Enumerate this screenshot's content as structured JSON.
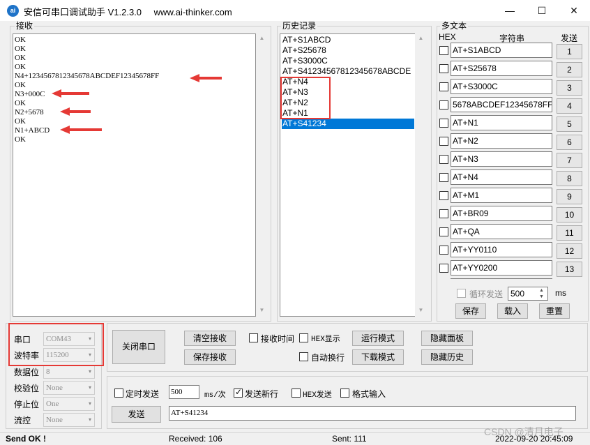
{
  "titlebar": {
    "logo_text": "ai",
    "title": "安信可串口调试助手 V1.2.3.0",
    "url": "www.ai-thinker.com",
    "minimize": "—",
    "maximize": "☐",
    "close": "✕"
  },
  "receive": {
    "label": "接收",
    "lines": [
      "OK",
      "OK",
      "OK",
      "OK",
      "N4+1234567812345678ABCDEF12345678FF",
      "OK",
      "N3+000C",
      "OK",
      "N2+5678",
      "OK",
      "N1+ABCD",
      "OK"
    ]
  },
  "history": {
    "label": "历史记录",
    "items": [
      "AT+S1ABCD",
      "AT+S25678",
      "AT+S3000C",
      "AT+S41234567812345678ABCDE",
      "AT+N4",
      "AT+N3",
      "AT+N2",
      "AT+N1",
      "AT+S41234"
    ],
    "selected_index": 8
  },
  "multitext": {
    "label": "多文本",
    "col_hex": "HEX",
    "col_string": "字符串",
    "col_send": "发送",
    "rows": [
      {
        "value": "AT+S1ABCD",
        "button": "1"
      },
      {
        "value": "AT+S25678",
        "button": "2"
      },
      {
        "value": "AT+S3000C",
        "button": "3"
      },
      {
        "value": "5678ABCDEF12345678FF",
        "button": "4"
      },
      {
        "value": "AT+N1",
        "button": "5"
      },
      {
        "value": "AT+N2",
        "button": "6"
      },
      {
        "value": "AT+N3",
        "button": "7"
      },
      {
        "value": "AT+N4",
        "button": "8"
      },
      {
        "value": "AT+M1",
        "button": "9"
      },
      {
        "value": "AT+BR09",
        "button": "10"
      },
      {
        "value": "AT+QA",
        "button": "11"
      },
      {
        "value": "AT+YY0110",
        "button": "12"
      },
      {
        "value": "AT+YY0200",
        "button": "13"
      }
    ],
    "loop_send_label": "循环发送",
    "loop_interval": "500",
    "loop_unit": "ms",
    "save_label": "保存",
    "load_label": "载入",
    "reset_label": "重置"
  },
  "port": {
    "port_label": "串口",
    "port_value": "COM43",
    "baud_label": "波特率",
    "baud_value": "115200",
    "databits_label": "数据位",
    "databits_value": "8",
    "parity_label": "校验位",
    "parity_value": "None",
    "stopbits_label": "停止位",
    "stopbits_value": "One",
    "flow_label": "流控",
    "flow_value": "None",
    "close_port_label": "关闭串口"
  },
  "controls": {
    "clear_recv": "清空接收",
    "save_recv": "保存接收",
    "recv_time": "接收时间",
    "hex_display": "HEX显示",
    "auto_wrap": "自动换行",
    "run_mode": "运行模式",
    "download_mode": "下载模式",
    "hide_panel": "隐藏面板",
    "hide_history": "隐藏历史"
  },
  "send": {
    "timed_send": "定时发送",
    "interval": "500",
    "interval_unit": "ms/次",
    "send_newline": "发送新行",
    "hex_send": "HEX发送",
    "format_input": "格式输入",
    "send_button": "发送",
    "send_text": "AT+S41234"
  },
  "status": {
    "send_status": "Send OK !",
    "received": "Received: 106",
    "sent": "Sent: 111",
    "datetime": "2022-09-20 20:45:09",
    "watermark": "CSDN @清月电子"
  },
  "colors": {
    "selection": "#0078d7",
    "annotation_red": "#e53935"
  }
}
